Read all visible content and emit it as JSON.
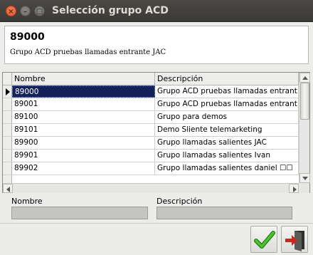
{
  "window": {
    "title": "Selección grupo ACD",
    "close_glyph": "×",
    "min_glyph": "–",
    "max_glyph": "□"
  },
  "info": {
    "code": "89000",
    "description": "Grupo ACD pruebas llamadas entrante JAC"
  },
  "table": {
    "columns": [
      "Nombre",
      "Descripción"
    ],
    "rows": [
      {
        "nombre": "89000",
        "descripcion": "Grupo ACD pruebas llamadas entrant"
      },
      {
        "nombre": "89001",
        "descripcion": "Grupo ACD pruebas llamadas entrant"
      },
      {
        "nombre": "89100",
        "descripcion": "Grupo para demos"
      },
      {
        "nombre": "89101",
        "descripcion": "Demo Sliente telemarketing"
      },
      {
        "nombre": "89900",
        "descripcion": "Grupo llamadas salientes JAC"
      },
      {
        "nombre": "89901",
        "descripcion": "Grupo llamadas salientes Ivan"
      },
      {
        "nombre": "89902",
        "descripcion": "Grupo llamadas salientes daniel ☐☐"
      }
    ],
    "selected_index": 0
  },
  "filters": {
    "nombre_label": "Nombre",
    "nombre_value": "",
    "descripcion_label": "Descripción",
    "descripcion_value": ""
  },
  "colors": {
    "selection": "#13235a",
    "accept_green": "#3aa31e",
    "exit_red": "#c8281e"
  }
}
